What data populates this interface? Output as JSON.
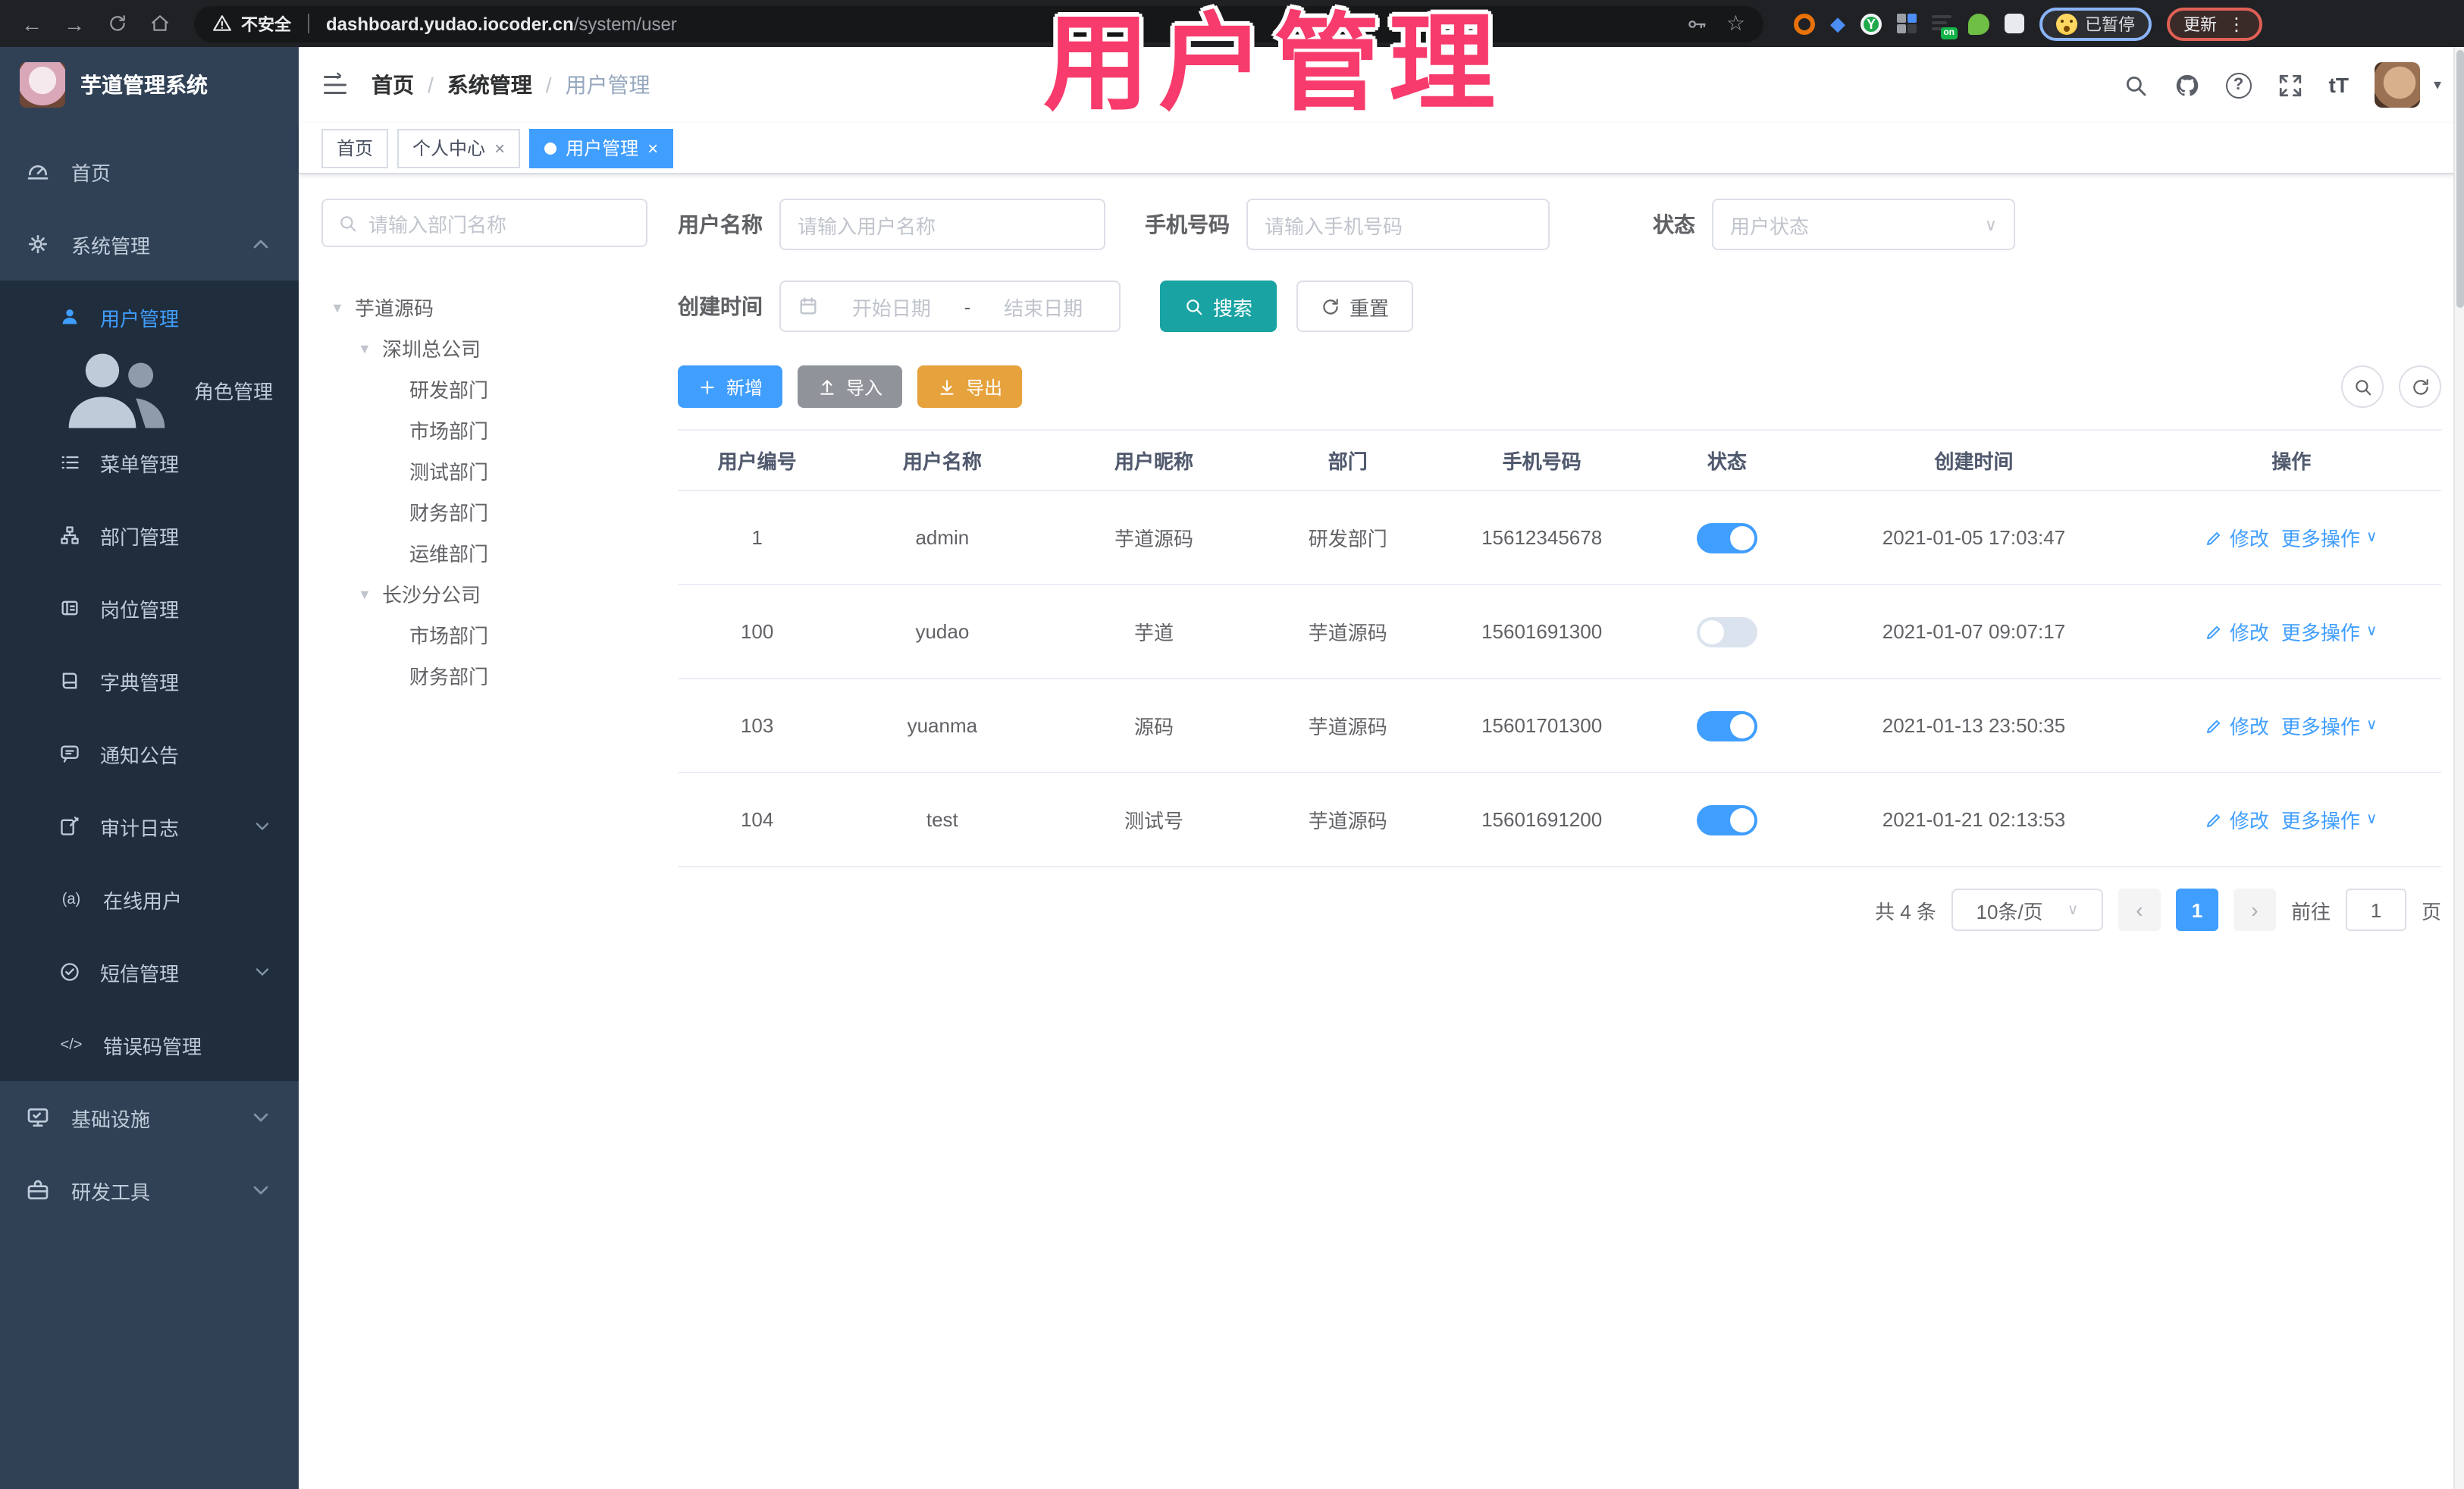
{
  "icons": {
    "back": "←",
    "forward": "→",
    "star": "☆",
    "more_vertical": "⋮",
    "online_users": "(a)",
    "error_code": "</>",
    "font_size": "tT",
    "select_caret": "∨",
    "dropdown_caret": "▾",
    "tree_arrow": "▼",
    "chevron_prev": "‹",
    "chevron_next": "›",
    "close": "×",
    "y_extension": "Y",
    "on_badge": "on"
  },
  "browser": {
    "security_label": "不安全",
    "url_host": "dashboard.yudao.iocoder.cn",
    "url_path": "/system/user",
    "paused_badge": "已暂停",
    "update_button": "更新"
  },
  "overlay": {
    "title": "用户管理",
    "color": "#f73b6c"
  },
  "app": {
    "logo_title": "芋道管理系统",
    "breadcrumb": [
      "首页",
      "系统管理",
      "用户管理"
    ],
    "breadcrumb_separator": "/",
    "tabs": [
      {
        "label": "首页",
        "closable": false,
        "active": false
      },
      {
        "label": "个人中心",
        "closable": true,
        "active": false
      },
      {
        "label": "用户管理",
        "closable": true,
        "active": true
      }
    ]
  },
  "sidebar": {
    "items": [
      {
        "label": "首页",
        "icon": "dashboard-icon",
        "level": "root"
      },
      {
        "label": "系统管理",
        "icon": "gear-icon",
        "level": "root",
        "state": "open"
      },
      {
        "label": "用户管理",
        "icon": "user-icon",
        "level": "sub",
        "active": true
      },
      {
        "label": "角色管理",
        "icon": "roles-icon",
        "level": "sub"
      },
      {
        "label": "菜单管理",
        "icon": "menu-list-icon",
        "level": "sub"
      },
      {
        "label": "部门管理",
        "icon": "org-tree-icon",
        "level": "sub"
      },
      {
        "label": "岗位管理",
        "icon": "id-badge-icon",
        "level": "sub"
      },
      {
        "label": "字典管理",
        "icon": "dictionary-icon",
        "level": "sub"
      },
      {
        "label": "通知公告",
        "icon": "announcement-icon",
        "level": "sub"
      },
      {
        "label": "审计日志",
        "icon": "audit-log-icon",
        "level": "sub",
        "state": "collapsed"
      },
      {
        "label": "在线用户",
        "icon": "online-users-icon",
        "level": "sub"
      },
      {
        "label": "短信管理",
        "icon": "sms-icon",
        "level": "sub",
        "state": "collapsed"
      },
      {
        "label": "错误码管理",
        "icon": "error-code-icon",
        "level": "sub"
      },
      {
        "label": "基础设施",
        "icon": "infrastructure-icon",
        "level": "root",
        "state": "collapsed"
      },
      {
        "label": "研发工具",
        "icon": "devtools-icon",
        "level": "root",
        "state": "collapsed"
      }
    ]
  },
  "dept_panel": {
    "search_placeholder": "请输入部门名称",
    "tree": [
      {
        "label": "芋道源码",
        "level": 0,
        "expandable": true
      },
      {
        "label": "深圳总公司",
        "level": 1,
        "expandable": true
      },
      {
        "label": "研发部门",
        "level": 2,
        "expandable": false
      },
      {
        "label": "市场部门",
        "level": 2,
        "expandable": false
      },
      {
        "label": "测试部门",
        "level": 2,
        "expandable": false
      },
      {
        "label": "财务部门",
        "level": 2,
        "expandable": false
      },
      {
        "label": "运维部门",
        "level": 2,
        "expandable": false
      },
      {
        "label": "长沙分公司",
        "level": 1,
        "expandable": true
      },
      {
        "label": "市场部门",
        "level": 2,
        "expandable": false
      },
      {
        "label": "财务部门",
        "level": 2,
        "expandable": false
      }
    ]
  },
  "filters": {
    "username_label": "用户名称",
    "username_placeholder": "请输入用户名称",
    "mobile_label": "手机号码",
    "mobile_placeholder": "请输入手机号码",
    "status_label": "状态",
    "status_placeholder": "用户状态",
    "create_time_label": "创建时间",
    "date_start_placeholder": "开始日期",
    "date_separator": "-",
    "date_end_placeholder": "结束日期",
    "search_button": "搜索",
    "reset_button": "重置"
  },
  "toolbar": {
    "add": "新增",
    "import": "导入",
    "export": "导出"
  },
  "table": {
    "columns": [
      "用户编号",
      "用户名称",
      "用户昵称",
      "部门",
      "手机号码",
      "状态",
      "创建时间",
      "操作"
    ],
    "action_edit": "修改",
    "action_more": "更多操作",
    "rows": [
      {
        "id": "1",
        "username": "admin",
        "nickname": "芋道源码",
        "dept": "研发部门",
        "mobile": "15612345678",
        "status": "on",
        "created": "2021-01-05 17:03:47"
      },
      {
        "id": "100",
        "username": "yudao",
        "nickname": "芋道",
        "dept": "芋道源码",
        "mobile": "15601691300",
        "status": "off",
        "created": "2021-01-07 09:07:17"
      },
      {
        "id": "103",
        "username": "yuanma",
        "nickname": "源码",
        "dept": "芋道源码",
        "mobile": "15601701300",
        "status": "on",
        "created": "2021-01-13 23:50:35"
      },
      {
        "id": "104",
        "username": "test",
        "nickname": "测试号",
        "dept": "芋道源码",
        "mobile": "15601691200",
        "status": "on",
        "created": "2021-01-21 02:13:53"
      }
    ]
  },
  "pagination": {
    "total_text": "共 4 条",
    "page_size": "10条/页",
    "current_page": "1",
    "goto_label": "前往",
    "goto_value": "1",
    "page_unit": "页"
  },
  "colors": {
    "accent": "#409eff",
    "search_button": "#1aa3a3",
    "export_button": "#e6a23c",
    "overlay_pink": "#f73b6c"
  }
}
